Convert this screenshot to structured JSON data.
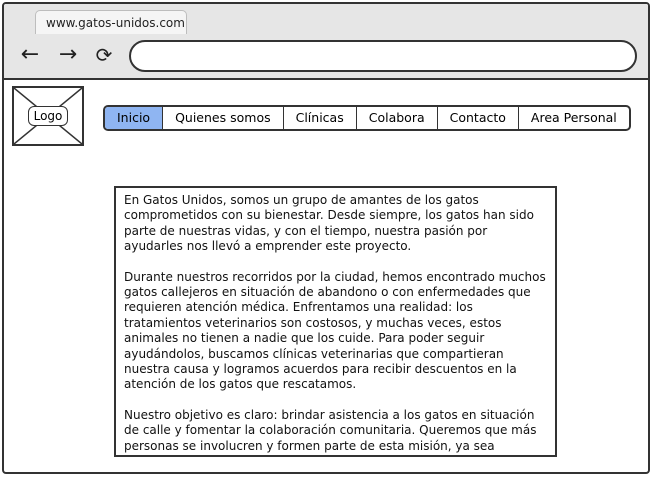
{
  "browser": {
    "tab_title": "www.gatos-unidos.com",
    "address_value": "",
    "back_icon": "←",
    "forward_icon": "→",
    "reload_icon": "⟳"
  },
  "logo": {
    "label": "Logo"
  },
  "menu": {
    "items": [
      {
        "label": "Inicio",
        "active": true
      },
      {
        "label": "Quienes somos",
        "active": false
      },
      {
        "label": "Clínicas",
        "active": false
      },
      {
        "label": "Colabora",
        "active": false
      },
      {
        "label": "Contacto",
        "active": false
      },
      {
        "label": "Area Personal",
        "active": false
      }
    ],
    "active_color": "#8fb5f2"
  },
  "content": {
    "paragraphs": [
      "En Gatos Unidos, somos un grupo de amantes de los gatos comprometidos con su bienestar. Desde siempre, los gatos han sido parte de nuestras vidas, y con el tiempo, nuestra pasión por ayudarles nos llevó a emprender este proyecto.",
      "Durante nuestros recorridos por la ciudad, hemos encontrado muchos gatos callejeros en situación de abandono o con enfermedades que requieren atención médica. Enfrentamos una realidad: los tratamientos veterinarios son costosos, y muchas veces, estos animales no tienen a nadie que los cuide. Para poder seguir ayudándolos, buscamos clínicas veterinarias que compartieran nuestra causa y logramos acuerdos para recibir descuentos en la atención de los gatos que rescatamos.",
      "Nuestro objetivo es claro: brindar asistencia a los gatos en situación de calle y fomentar la colaboración comunitaria. Queremos que más personas se involucren y formen parte de esta misión, ya sea reportando casos de gatos en riesgo, realizando donaciones o"
    ]
  }
}
